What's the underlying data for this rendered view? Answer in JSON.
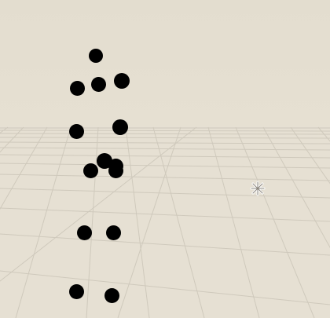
{
  "scene": {
    "background_color": "#e4ded1",
    "grid_line_color": "#c9c3b5",
    "point_color": "#000000",
    "point_count": 15
  },
  "cursor": {
    "icon": "crosshair-cursor-icon"
  }
}
